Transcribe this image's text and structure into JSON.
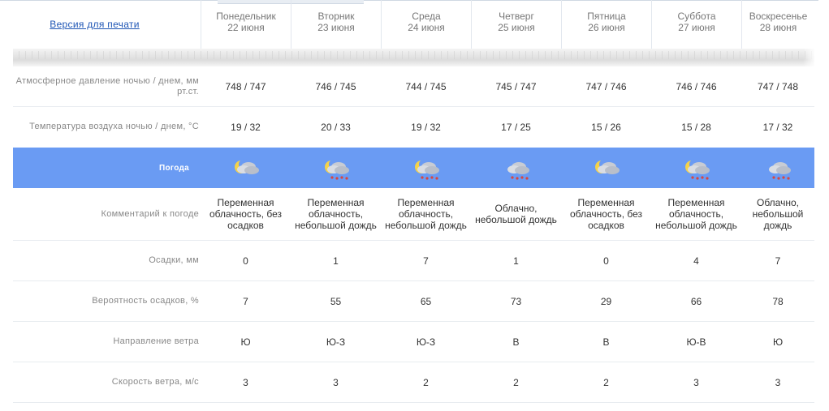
{
  "print_link": "Версия для печати",
  "days": [
    {
      "name": "Понедельник",
      "date": "22 июня"
    },
    {
      "name": "Вторник",
      "date": "23 июня"
    },
    {
      "name": "Среда",
      "date": "24 июня"
    },
    {
      "name": "Четверг",
      "date": "25 июня"
    },
    {
      "name": "Пятница",
      "date": "26 июня"
    },
    {
      "name": "Суббота",
      "date": "27 июня"
    },
    {
      "name": "Воскресенье",
      "date": "28 июня"
    }
  ],
  "rows": {
    "pressure": {
      "label": "Атмосферное давление ночью  /  днем, мм рт.ст.",
      "values": [
        "748 / 747",
        "746 / 745",
        "744 / 745",
        "745 / 747",
        "747 / 746",
        "746 / 746",
        "747 / 748"
      ]
    },
    "temperature": {
      "label": "Температура воздуха ночью  /  днем, °С",
      "values": [
        "19 / 32",
        "20 / 33",
        "19 / 32",
        "17 / 25",
        "15 / 26",
        "15 / 28",
        "17 / 32"
      ]
    },
    "weather": {
      "label": "Погода",
      "icons": [
        "moon-cloud-icon",
        "moon-cloud-rain-icon",
        "moon-cloud-rain-icon",
        "cloud-rain-icon",
        "moon-cloud-icon",
        "moon-cloud-rain-icon",
        "cloud-rain-icon"
      ]
    },
    "comment": {
      "label": "Комментарий к погоде",
      "values": [
        "Переменная облачность, без осадков",
        "Переменная облачность, небольшой дождь",
        "Переменная облачность, небольшой дождь",
        "Облачно, небольшой дождь",
        "Переменная облачность, без осадков",
        "Переменная облачность, небольшой дождь",
        "Облачно, небольшой дождь"
      ]
    },
    "precip": {
      "label": "Осадки, мм",
      "values": [
        "0",
        "1",
        "7",
        "1",
        "0",
        "4",
        "7"
      ]
    },
    "probability": {
      "label": "Вероятность осадков, %",
      "values": [
        "7",
        "55",
        "65",
        "73",
        "29",
        "66",
        "78"
      ]
    },
    "wind_dir": {
      "label": "Направление ветра",
      "values": [
        "Ю",
        "Ю-З",
        "Ю-З",
        "В",
        "В",
        "Ю-В",
        "Ю"
      ]
    },
    "wind_speed": {
      "label": "Скорость ветра, м/с",
      "values": [
        "3",
        "3",
        "2",
        "2",
        "2",
        "3",
        "3"
      ]
    }
  },
  "colors": {
    "weather_row_bg": "#6a9bf3",
    "link": "#1f56b5",
    "label_text": "#888888"
  }
}
